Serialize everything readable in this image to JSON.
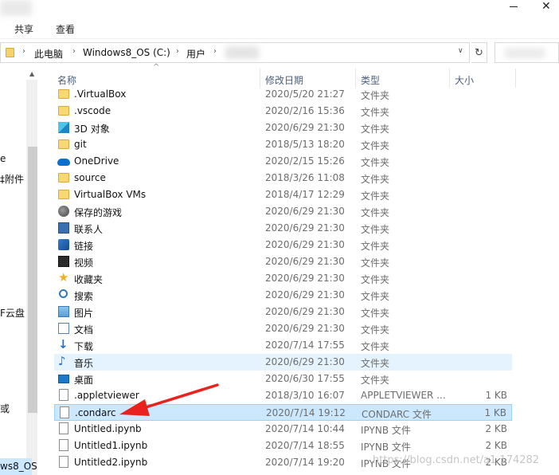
{
  "ribbon": {
    "share_label": "共享",
    "view_label": "查看"
  },
  "window": {
    "close_glyph": "✕"
  },
  "address": {
    "crumbs": [
      "此电脑",
      "Windows8_OS (C:)",
      "用户"
    ],
    "refresh_glyph": "↻",
    "dropdown_glyph": "∨"
  },
  "nav": {
    "items": [
      "e",
      "‡附件",
      "F云盘",
      "或",
      "ws8_OS"
    ]
  },
  "columns": {
    "name": "名称",
    "date": "修改日期",
    "type": "类型",
    "size": "大小"
  },
  "files": [
    {
      "name": ".VirtualBox",
      "date": "2020/5/20 21:27",
      "type": "文件夹",
      "size": "",
      "icon": "folder-icon"
    },
    {
      "name": ".vscode",
      "date": "2020/2/16 15:36",
      "type": "文件夹",
      "size": "",
      "icon": "folder-icon"
    },
    {
      "name": "3D 对象",
      "date": "2020/6/29 21:30",
      "type": "文件夹",
      "size": "",
      "icon": "3d-objects-icon"
    },
    {
      "name": "git",
      "date": "2018/5/13 18:20",
      "type": "文件夹",
      "size": "",
      "icon": "folder-icon"
    },
    {
      "name": "OneDrive",
      "date": "2020/2/15 15:26",
      "type": "文件夹",
      "size": "",
      "icon": "onedrive-icon"
    },
    {
      "name": "source",
      "date": "2018/3/26 11:08",
      "type": "文件夹",
      "size": "",
      "icon": "folder-icon"
    },
    {
      "name": "VirtualBox VMs",
      "date": "2018/4/17 12:29",
      "type": "文件夹",
      "size": "",
      "icon": "folder-icon"
    },
    {
      "name": "保存的游戏",
      "date": "2020/6/29 21:30",
      "type": "文件夹",
      "size": "",
      "icon": "saved-games-icon"
    },
    {
      "name": "联系人",
      "date": "2020/6/29 21:30",
      "type": "文件夹",
      "size": "",
      "icon": "contacts-icon"
    },
    {
      "name": "链接",
      "date": "2020/6/29 21:30",
      "type": "文件夹",
      "size": "",
      "icon": "links-icon"
    },
    {
      "name": "视频",
      "date": "2020/6/29 21:30",
      "type": "文件夹",
      "size": "",
      "icon": "videos-icon"
    },
    {
      "name": "收藏夹",
      "date": "2020/6/29 21:30",
      "type": "文件夹",
      "size": "",
      "icon": "favorites-icon"
    },
    {
      "name": "搜索",
      "date": "2020/6/29 21:30",
      "type": "文件夹",
      "size": "",
      "icon": "searches-icon"
    },
    {
      "name": "图片",
      "date": "2020/6/29 21:30",
      "type": "文件夹",
      "size": "",
      "icon": "pictures-icon"
    },
    {
      "name": "文档",
      "date": "2020/6/29 21:30",
      "type": "文件夹",
      "size": "",
      "icon": "documents-icon"
    },
    {
      "name": "下载",
      "date": "2020/7/14 17:55",
      "type": "文件夹",
      "size": "",
      "icon": "downloads-icon"
    },
    {
      "name": "音乐",
      "date": "2020/6/29 21:30",
      "type": "文件夹",
      "size": "",
      "icon": "music-icon"
    },
    {
      "name": "桌面",
      "date": "2020/6/30 17:55",
      "type": "文件夹",
      "size": "",
      "icon": "desktop-icon"
    },
    {
      "name": ".appletviewer",
      "date": "2018/3/10 16:07",
      "type": "APPLETVIEWER ...",
      "size": "1 KB",
      "icon": "file-icon"
    },
    {
      "name": ".condarc",
      "date": "2020/7/14 19:12",
      "type": "CONDARC 文件",
      "size": "1 KB",
      "icon": "file-icon"
    },
    {
      "name": "Untitled.ipynb",
      "date": "2020/7/14 10:44",
      "type": "IPYNB 文件",
      "size": "2 KB",
      "icon": "file-icon"
    },
    {
      "name": "Untitled1.ipynb",
      "date": "2020/7/14 18:55",
      "type": "IPYNB 文件",
      "size": "2 KB",
      "icon": "file-icon"
    },
    {
      "name": "Untitled2.ipynb",
      "date": "2020/7/14 19:20",
      "type": "IPYNB 文件",
      "size": "2 KB",
      "icon": "file-icon"
    }
  ],
  "state": {
    "hover_row": 16,
    "selected_row": 19
  },
  "annotation": {
    "arrow_color": "#e8231f"
  },
  "watermark": "https://blog.csdn.net/a1  174282"
}
